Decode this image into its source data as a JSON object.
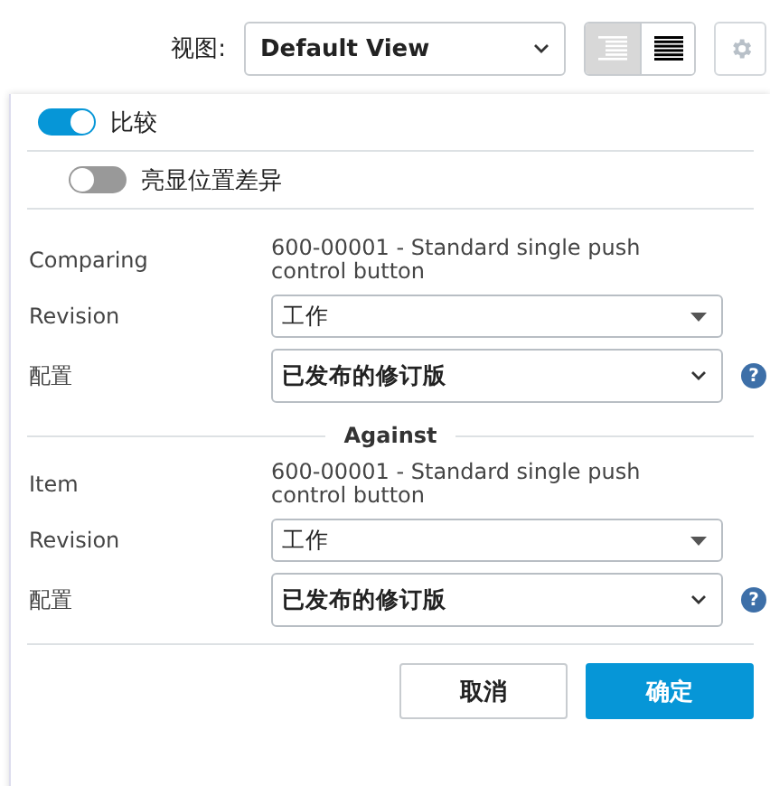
{
  "toolbar": {
    "view_label": "视图:",
    "view_value": "Default View",
    "layout_buttons": [
      {
        "kind": "indented",
        "selected": true
      },
      {
        "kind": "full",
        "selected": false
      }
    ],
    "settings_disabled": true
  },
  "panel": {
    "toggles": [
      {
        "label": "比较",
        "on": true,
        "indent": false
      },
      {
        "label": "亮显位置差异",
        "on": false,
        "indent": true
      }
    ],
    "sections": [
      {
        "rows": [
          {
            "kind": "text",
            "label": "Comparing",
            "value": "600-00001 - Standard single push control button"
          },
          {
            "kind": "select",
            "label": "Revision",
            "value": "工作"
          },
          {
            "kind": "dropdown",
            "label": "配置",
            "value": "已发布的修订版",
            "help": "?"
          }
        ]
      },
      {
        "heading": "Against",
        "rows": [
          {
            "kind": "text",
            "label": "Item",
            "value": "600-00001 - Standard single push control button"
          },
          {
            "kind": "select",
            "label": "Revision",
            "value": "工作"
          },
          {
            "kind": "dropdown",
            "label": "配置",
            "value": "已发布的修订版",
            "help": "?"
          }
        ]
      }
    ],
    "buttons": [
      {
        "label": "取消",
        "primary": false
      },
      {
        "label": "确定",
        "primary": true
      }
    ]
  }
}
